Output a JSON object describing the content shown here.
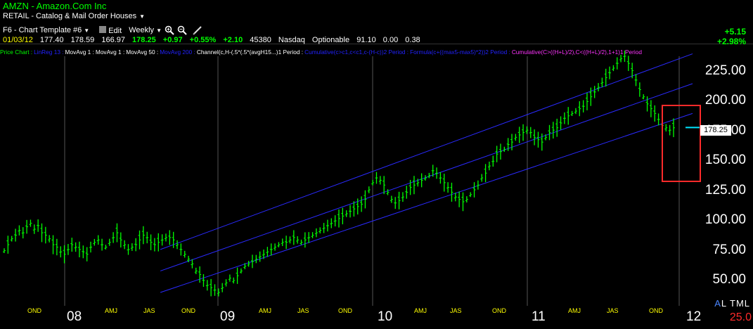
{
  "header": {
    "symbol_line": "AMZN  - Amazon.Com Inc",
    "sector": "RETAIL - Catalog & Mail Order Houses",
    "sector_dropdown_icon": "triangle-down"
  },
  "toolbar": {
    "template": "F6 - Chart Template #6",
    "edit_label": "Edit",
    "period": "Weekly",
    "icons": [
      "zoom-in-icon",
      "zoom-out-icon",
      "pencil-icon"
    ]
  },
  "quote": {
    "date": "01/03/12",
    "open": "177.40",
    "high": "178.59",
    "low": "166.97",
    "close": "178.25",
    "change": "+0.97",
    "change_pct": "+0.55%",
    "change2": "+2.10",
    "volume": "45380",
    "exchange": "Nasdaq",
    "optionable": "Optionable",
    "v1": "91.10",
    "v2": "0.00",
    "v3": "0.38",
    "right_change": "+5.15",
    "right_change_pct": "+2.98%"
  },
  "studies": [
    {
      "text": "Price Chart",
      "color": "#00ff00"
    },
    {
      "text": "LinReg 13",
      "color": "#2222ff"
    },
    {
      "text": "MovAvg 1",
      "color": "#ffffff"
    },
    {
      "text": "MovAvg 1",
      "color": "#ffffff"
    },
    {
      "text": "MovAvg 50",
      "color": "#ffffff"
    },
    {
      "text": "MovAvg 200",
      "color": "#2222ff"
    },
    {
      "text": "Channel(c,H-(.5*(.5*(avgH15...)1 Period",
      "color": "#ffffff"
    },
    {
      "text": "Cumulative(c>c1,c<c1,c-(H-c))2 Period",
      "color": "#2222ff"
    },
    {
      "text": "Formula(c+((max5-max5)*2))2 Period",
      "color": "#2222ff"
    },
    {
      "text": "Cumulative(C>((H+L)/2),C<((H+L)/2),1+1)1 Period",
      "color": "#ff33ff"
    }
  ],
  "y_axis": [
    "225.00",
    "200.00",
    "175.00",
    "150.00",
    "125.00",
    "100.00",
    "75.00",
    "50.00"
  ],
  "last_price_tag": "178.25",
  "x_axis_quarters": [
    "OND",
    "AMJ",
    "JAS",
    "OND",
    "AMJ",
    "JAS",
    "OND",
    "AMJ",
    "JAS",
    "OND",
    "AMJ",
    "JAS",
    "OND"
  ],
  "x_axis_years": [
    "08",
    "09",
    "10",
    "11",
    "12"
  ],
  "corner": {
    "a": "A",
    "letters": "L TML",
    "number": "25.0"
  },
  "colors": {
    "price_bars": "#00ff00",
    "channel": "#2a2aff",
    "highlight_box": "#ff2a2a",
    "last_price_line": "#00e5ff",
    "grid": "#555555"
  },
  "chart_data": {
    "type": "ohlc",
    "symbol": "AMZN",
    "period": "Weekly",
    "ylim": [
      30,
      245
    ],
    "weekly_closes_approx": [
      75,
      80,
      85,
      88,
      92,
      90,
      95,
      98,
      93,
      96,
      90,
      88,
      85,
      80,
      78,
      74,
      72,
      76,
      80,
      78,
      76,
      74,
      72,
      78,
      82,
      84,
      80,
      78,
      82,
      86,
      90,
      84,
      80,
      76,
      78,
      80,
      84,
      88,
      86,
      82,
      80,
      82,
      84,
      86,
      86,
      84,
      80,
      76,
      72,
      68,
      64,
      58,
      55,
      50,
      46,
      44,
      42,
      40,
      44,
      48,
      52,
      50,
      54,
      58,
      62,
      64,
      66,
      68,
      70,
      72,
      74,
      76,
      78,
      80,
      82,
      82,
      84,
      86,
      84,
      82,
      84,
      86,
      88,
      90,
      92,
      94,
      96,
      98,
      100,
      102,
      104,
      106,
      108,
      110,
      112,
      114,
      118,
      126,
      132,
      136,
      134,
      130,
      124,
      118,
      115,
      117,
      120,
      124,
      128,
      130,
      132,
      134,
      136,
      138,
      142,
      140,
      136,
      132,
      128,
      124,
      120,
      118,
      116,
      118,
      122,
      126,
      130,
      136,
      140,
      146,
      150,
      156,
      158,
      160,
      164,
      166,
      170,
      172,
      174,
      176,
      174,
      170,
      168,
      166,
      170,
      174,
      176,
      178,
      182,
      186,
      188,
      190,
      192,
      194,
      196,
      200,
      204,
      208,
      212,
      216,
      220,
      224,
      228,
      232,
      236,
      238,
      232,
      226,
      218,
      210,
      204,
      198,
      194,
      190,
      185,
      180,
      178,
      176,
      178
    ],
    "channel_upper": [
      [
        0.23,
        76
      ],
      [
        1.0,
        240
      ]
    ],
    "channel_mid": [
      [
        0.23,
        58
      ],
      [
        1.0,
        215
      ]
    ],
    "channel_lower": [
      [
        0.23,
        40
      ],
      [
        1.0,
        190
      ]
    ],
    "last_price": 178.25
  }
}
